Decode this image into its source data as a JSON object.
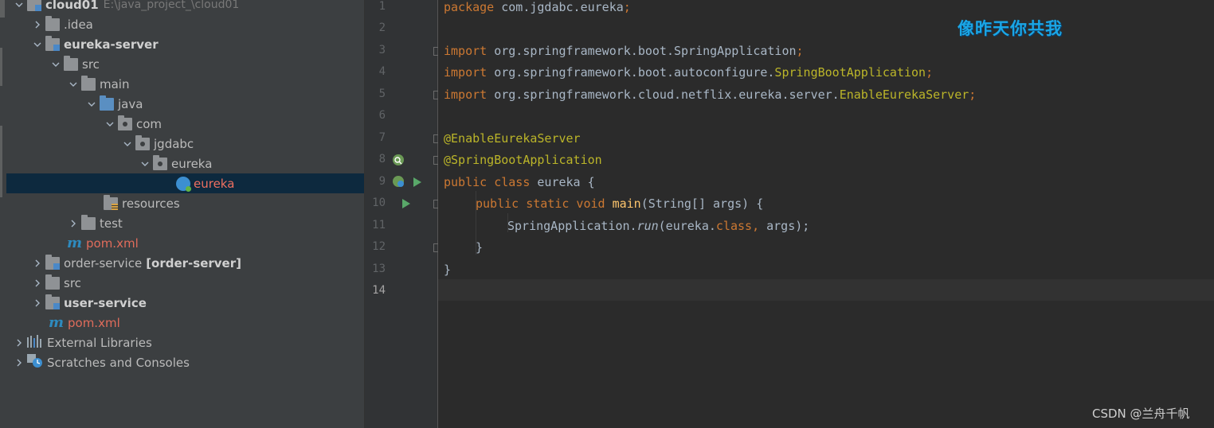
{
  "project_tree": {
    "rows": [
      {
        "label": "cloud01",
        "path": "E:\\java_project_\\cloud01"
      },
      {
        "label": ".idea"
      },
      {
        "label": "eureka-server"
      },
      {
        "label": "src"
      },
      {
        "label": "main"
      },
      {
        "label": "java"
      },
      {
        "label": "com"
      },
      {
        "label": "jgdabc"
      },
      {
        "label": "eureka"
      },
      {
        "label": "eureka"
      },
      {
        "label": "resources"
      },
      {
        "label": "test"
      },
      {
        "label": "pom.xml"
      },
      {
        "label": "order-service",
        "module": "[order-server]"
      },
      {
        "label": "src"
      },
      {
        "label": "user-service"
      },
      {
        "label": "pom.xml"
      },
      {
        "label": "External Libraries"
      },
      {
        "label": "Scratches and Consoles"
      }
    ],
    "maven_glyph": "m",
    "icons": [
      "folder-icon",
      "module-folder-icon",
      "source-folder-icon",
      "package-icon",
      "resources-folder-icon",
      "spring-boot-class-icon",
      "maven-icon",
      "libraries-icon",
      "scratches-icon"
    ]
  },
  "editor": {
    "line_numbers": [
      "1",
      "2",
      "3",
      "4",
      "5",
      "6",
      "7",
      "8",
      "9",
      "10",
      "11",
      "12",
      "13",
      "14"
    ],
    "lines": [
      {
        "t1": "package",
        "t2": " com.jgdabc.eureka",
        "t3": ";"
      },
      {},
      {
        "t1": "import",
        "t2": " org.springframework.boot.SpringApplication",
        "t3": ";"
      },
      {
        "t1": "import",
        "t2": " org.springframework.boot.autoconfigure.",
        "t4": "SpringBootApplication",
        "t3": ";"
      },
      {
        "t1": "import",
        "t2": " org.springframework.cloud.netflix.eureka.server.",
        "t4": "EnableEurekaServer",
        "t3": ";"
      },
      {},
      {
        "t1": "@EnableEurekaServer"
      },
      {
        "t1": "@SpringBootApplication"
      },
      {
        "t1": "public class",
        "t2": " eureka {"
      },
      {
        "t1": "public static void",
        "t5": " main",
        "t2": "(String[] args) {"
      },
      {
        "t2": "SpringApplication.",
        "t6": "run",
        "t7": "(eureka.",
        "t8": "class",
        "t9": ",",
        "t10": " args);"
      },
      {
        "t2": "}"
      },
      {
        "t2": "}"
      },
      {}
    ],
    "current_line": "14"
  },
  "overlay": {
    "lyric": "像昨天你共我",
    "watermark": "CSDN @兰舟千帆"
  },
  "colors": {
    "background": "#2b2b2b",
    "panel": "#3c3f41",
    "keyword": "#cc7832",
    "annotation": "#bbb529",
    "method": "#ffc66d",
    "selection": "#0d293e",
    "lyric": "#1aa6e6"
  }
}
